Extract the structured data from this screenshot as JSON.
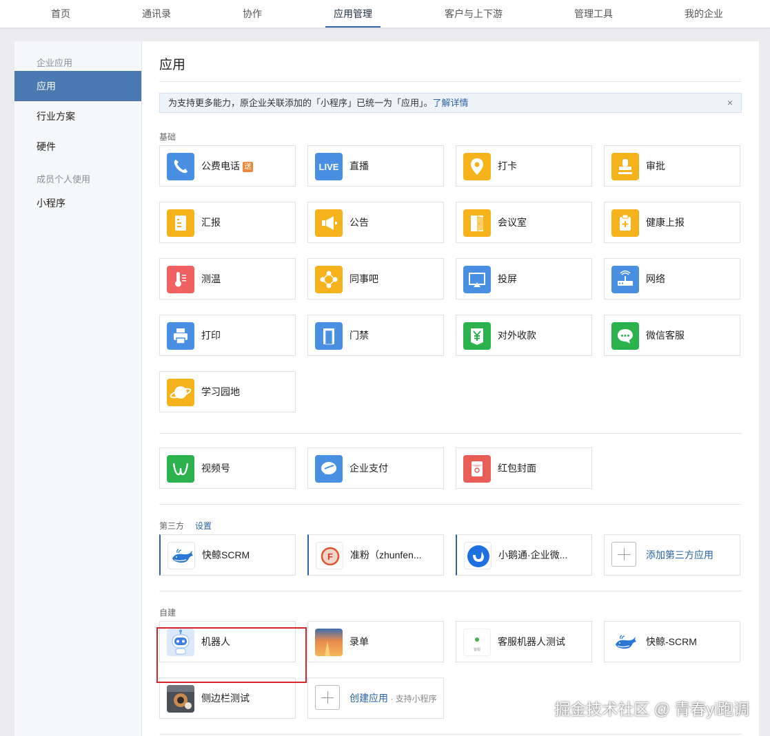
{
  "topnav": {
    "tabs": [
      "首页",
      "通讯录",
      "协作",
      "应用管理",
      "客户与上下游",
      "管理工具",
      "我的企业"
    ]
  },
  "sidebar": {
    "section1": "企业应用",
    "items1": [
      "应用",
      "行业方案",
      "硬件"
    ],
    "section2": "成员个人使用",
    "items2": [
      "小程序"
    ]
  },
  "main": {
    "title": "应用",
    "notice": {
      "text": "为支持更多能力，原企业关联添加的「小程序」已统一为「应用」。",
      "link": "了解详情",
      "close": "×"
    },
    "basic_label": "基础",
    "basic_apps": [
      {
        "name": "公费电话",
        "badge": "送",
        "icon": "phone-icon"
      },
      {
        "name": "直播",
        "icon": "live-icon",
        "icon_text": "LIVE"
      },
      {
        "name": "打卡",
        "icon": "location-pin-icon"
      },
      {
        "name": "审批",
        "icon": "stamp-icon"
      },
      {
        "name": "汇报",
        "icon": "report-icon"
      },
      {
        "name": "公告",
        "icon": "megaphone-icon"
      },
      {
        "name": "会议室",
        "icon": "door-icon"
      },
      {
        "name": "健康上报",
        "icon": "health-report-icon"
      },
      {
        "name": "测温",
        "icon": "thermometer-icon"
      },
      {
        "name": "同事吧",
        "icon": "colleague-icon"
      },
      {
        "name": "投屏",
        "icon": "screen-cast-icon"
      },
      {
        "name": "网络",
        "icon": "router-icon"
      },
      {
        "name": "打印",
        "icon": "printer-icon"
      },
      {
        "name": "门禁",
        "icon": "access-door-icon"
      },
      {
        "name": "对外收款",
        "icon": "yuan-wallet-icon"
      },
      {
        "name": "微信客服",
        "icon": "chat-bubble-icon"
      },
      {
        "name": "学习园地",
        "icon": "planet-icon"
      }
    ],
    "wechat_apps": [
      {
        "name": "视频号",
        "icon": "channels-icon"
      },
      {
        "name": "企业支付",
        "icon": "pay-icon"
      },
      {
        "name": "红包封面",
        "icon": "red-envelope-icon"
      }
    ],
    "third_party_label": "第三方",
    "third_party_settings": "设置",
    "third_party_apps": [
      {
        "name": "快鲸SCRM",
        "icon": "whale-icon"
      },
      {
        "name": "准粉（zhunfen...",
        "icon": "zhunfen-logo-icon",
        "icon_text": "F"
      },
      {
        "name": "小鹅通·企业微...",
        "icon": "xiaoetong-logo-icon"
      }
    ],
    "add_third_party": "添加第三方应用",
    "custom_label": "自建",
    "custom_apps": [
      {
        "name": "机器人",
        "icon": "robot-icon"
      },
      {
        "name": "录单",
        "icon": "sunset-image-icon"
      },
      {
        "name": "客服机器人测试",
        "icon": "service-bot-icon",
        "icon_text": "客服"
      },
      {
        "name": "快鲸-SCRM",
        "icon": "whale-icon"
      },
      {
        "name": "侧边栏测试",
        "icon": "photo-thumbnail-icon"
      }
    ],
    "create_app": {
      "label": "创建应用",
      "sub": " · 支持小程序"
    }
  },
  "watermark": "掘金技术社区 @ 青春yi跑调",
  "colors": {
    "accent": "#2a64a6",
    "sidebar_active": "#4b7ab3",
    "highlight_box": "#d9232a"
  }
}
